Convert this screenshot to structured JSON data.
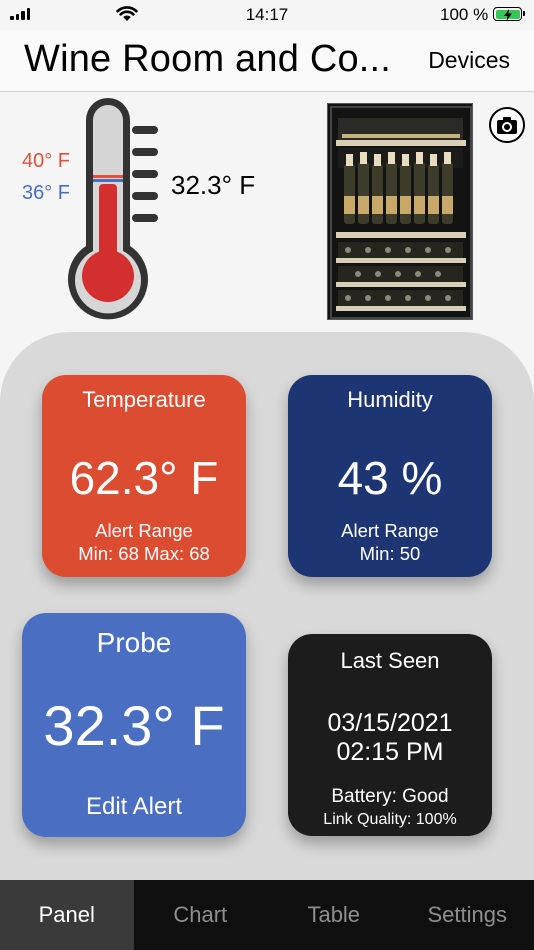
{
  "status_bar": {
    "time": "14:17",
    "battery_percent": "100 %",
    "signal_icon": "signal-bars-icon",
    "wifi_icon": "wifi-icon",
    "battery_icon": "battery-charging-icon",
    "battery_color": "#35c759"
  },
  "header": {
    "title": "Wine Room and Co...",
    "devices_label": "Devices"
  },
  "overview": {
    "high_limit": "40° F",
    "low_limit": "36° F",
    "probe_reading": "32.3° F",
    "thermometer_icon": "thermometer-icon",
    "camera_icon": "camera-icon",
    "high_color": "#e0523b",
    "low_color": "#4a6fc2"
  },
  "cards": {
    "temperature": {
      "title": "Temperature",
      "value": "62.3° F",
      "alert_label": "Alert Range",
      "alert_range": "Min: 68 Max: 68",
      "color": "#dc4c30"
    },
    "humidity": {
      "title": "Humidity",
      "value": "43 %",
      "alert_label": "Alert Range",
      "alert_range": "Min: 50",
      "color": "#1e3574"
    },
    "probe": {
      "title": "Probe",
      "value": "32.3° F",
      "action": "Edit Alert",
      "color": "#4a6fc2"
    },
    "last_seen": {
      "title": "Last Seen",
      "date": "03/15/2021",
      "time": "02:15 PM",
      "battery": "Battery: Good",
      "link_quality": "Link Quality: 100%",
      "color": "#1c1c1c"
    }
  },
  "tabs": [
    {
      "label": "Panel",
      "active": true
    },
    {
      "label": "Chart",
      "active": false
    },
    {
      "label": "Table",
      "active": false
    },
    {
      "label": "Settings",
      "active": false
    }
  ]
}
